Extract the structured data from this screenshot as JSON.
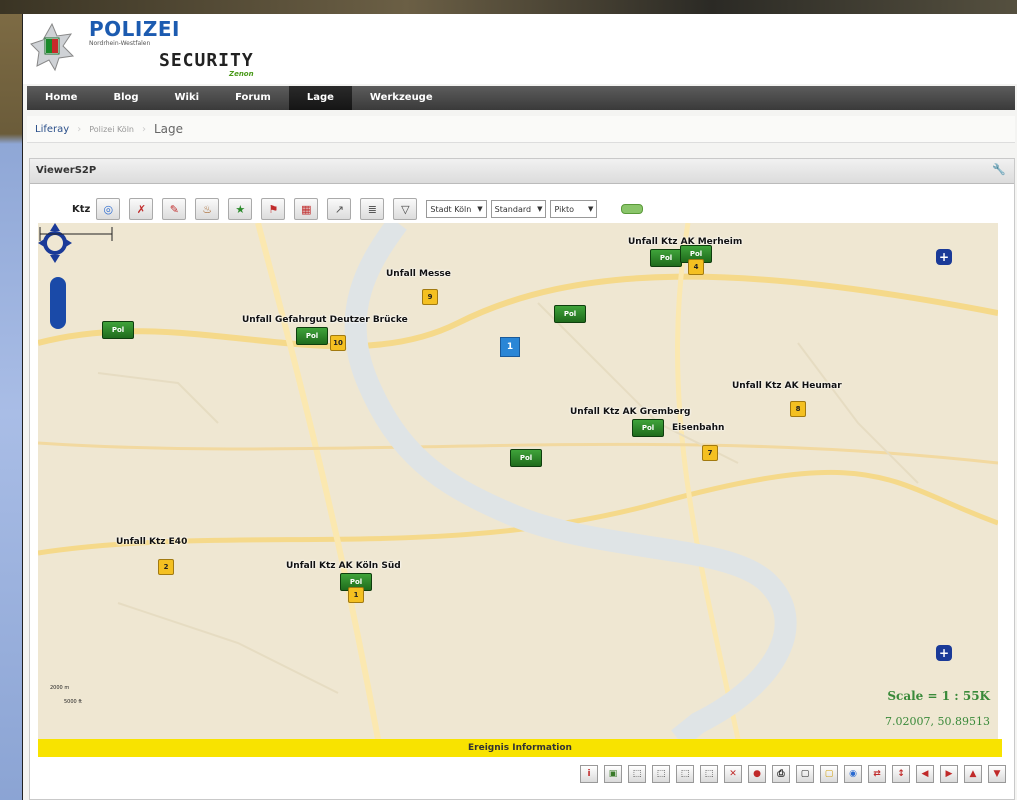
{
  "header": {
    "brand": "POLIZEI",
    "region": "Nordrhein-Westfalen",
    "product": "SECURITY",
    "tagline": "Zenon"
  },
  "nav": {
    "items": [
      "Home",
      "Blog",
      "Wiki",
      "Forum",
      "Lage",
      "Werkzeuge"
    ],
    "active": "Lage"
  },
  "breadcrumb": [
    "Liferay",
    "Polizei Köln",
    "Lage"
  ],
  "portlet": {
    "title": "ViewerS2P",
    "wrench_icon": "wrench-icon"
  },
  "toolbar": {
    "label": "Ktz",
    "selects": [
      "Stadt Köln",
      "Standard",
      "Pikto"
    ]
  },
  "map": {
    "labels": [
      "Unfall Ktz AK Merheim",
      "Unfall Messe",
      "Unfall Gefahrgut Deutzer Brücke",
      "Unfall Ktz AK Heumar",
      "Unfall Ktz AK Gremberg",
      "Eisenbahn",
      "Unfall Ktz E40",
      "Unfall Ktz AK Köln Süd"
    ],
    "pol_label": "Pol",
    "markers": [
      "9",
      "10",
      "1",
      "8",
      "7",
      "2",
      "1",
      "4"
    ],
    "scale_labels": [
      "2000 m",
      "5000 ft"
    ],
    "scale_text": "Scale = 1 : 55K",
    "coords": "7.02007, 50.89513"
  },
  "infobar": {
    "text": "Ereignis Information"
  },
  "colors": {
    "nav": "#3a3a3a",
    "info": "#f8e300",
    "pol": "#2f8a2a",
    "marker": "#f4c021",
    "brand": "#1c5bb0"
  }
}
